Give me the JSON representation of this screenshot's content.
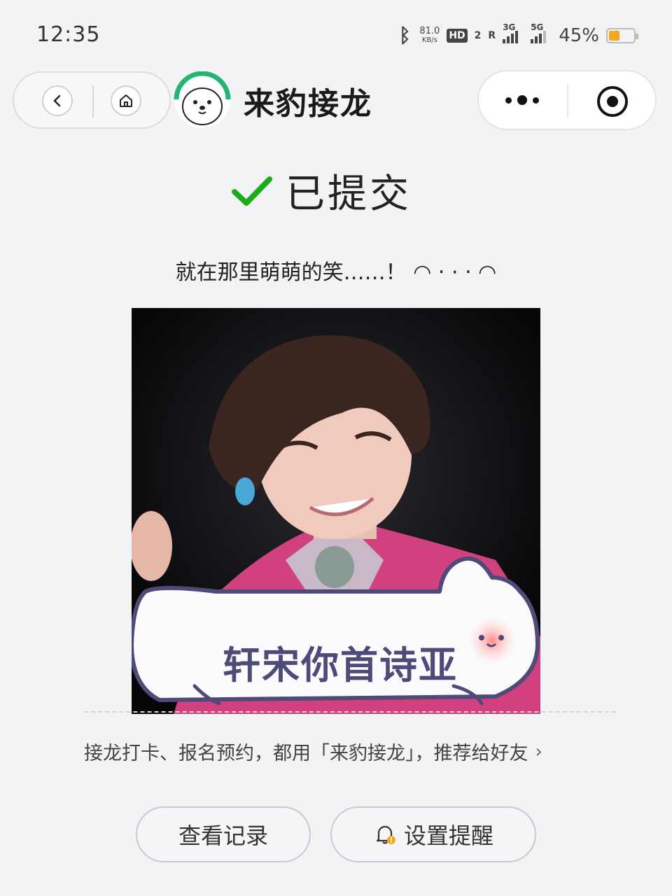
{
  "status_bar": {
    "time": "12:35",
    "net_speed": "81.0",
    "net_unit": "KB/s",
    "hd": "HD",
    "hd_sub": "2",
    "roaming": "R",
    "sig1": "3G",
    "sig2": "5G",
    "battery_pct": "45%",
    "battery_level": 0.45,
    "battery_color": "#f5a623"
  },
  "header": {
    "title": "来豹接龙",
    "back_icon": "chevron-left-icon",
    "home_icon": "home-icon",
    "more_icon": "more-dots-icon",
    "close_icon": "target-icon"
  },
  "result": {
    "status_text": "已提交",
    "check_color": "#1aad19",
    "message": "就在那里萌萌的笑……！ ◠ ‧ · ‧ ◠",
    "bubble_text": "轩宋你首诗亚"
  },
  "footer": {
    "recommend_text": "接龙打卡、报名预约，都用「来豹接龙」，推荐给好友",
    "view_records": "查看记录",
    "set_reminder": "设置提醒"
  }
}
